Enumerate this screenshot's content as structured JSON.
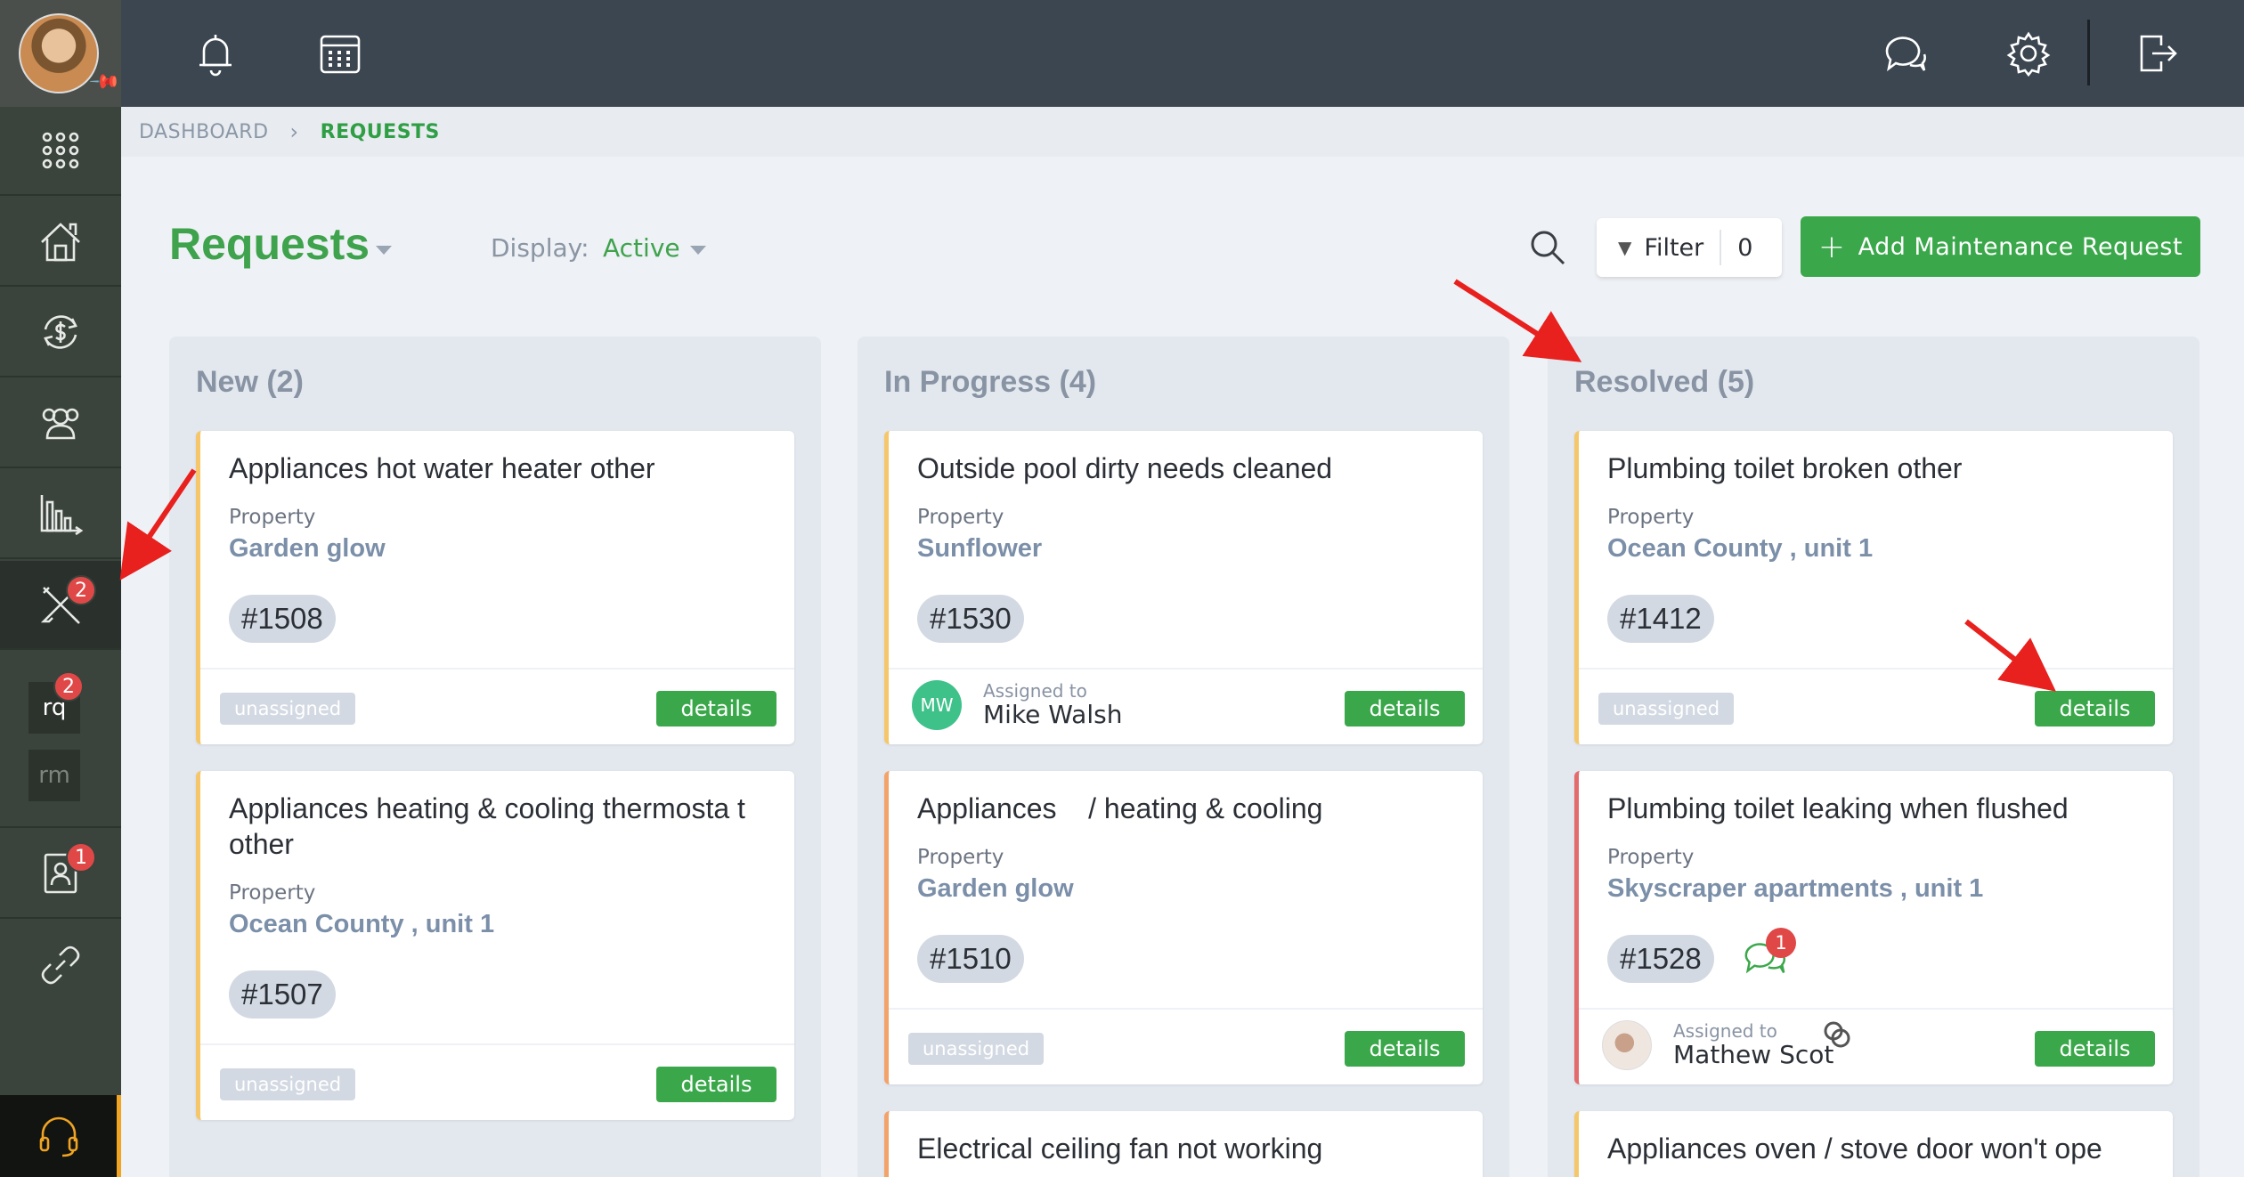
{
  "sidebar": {
    "badges": {
      "maintenance": "2",
      "rq": "2",
      "tenants": "1"
    },
    "sub_items": [
      "rq",
      "rm"
    ]
  },
  "breadcrumb": {
    "items": [
      "DASHBOARD"
    ],
    "current": "REQUESTS"
  },
  "header": {
    "title": "Requests",
    "display_label": "Display:",
    "display_value": "Active",
    "filter_label": "Filter",
    "filter_count": "0",
    "add_button": "Add Maintenance Request"
  },
  "columns": [
    {
      "title": "New (2)",
      "cards": [
        {
          "title": "Appliances hot water heater other",
          "property_label": "Property",
          "property": "Garden glow",
          "id": "#1508",
          "status": "unassigned",
          "details": "details"
        },
        {
          "title": "Appliances heating & cooling thermosta t other",
          "property_label": "Property",
          "property": "Ocean County , unit 1",
          "id": "#1507",
          "status": "unassigned",
          "details": "details"
        }
      ]
    },
    {
      "title": "In Progress (4)",
      "cards": [
        {
          "title": "Outside pool dirty needs cleaned",
          "property_label": "Property",
          "property": "Sunflower",
          "id": "#1530",
          "assigned_label": "Assigned to",
          "assignee_initials": "MW",
          "assignee": "Mike Walsh",
          "details": "details"
        },
        {
          "title": "Appliances    / heating & cooling",
          "property_label": "Property",
          "property": "Garden glow",
          "id": "#1510",
          "status": "unassigned",
          "details": "details"
        },
        {
          "title": "Electrical ceiling fan not working"
        }
      ]
    },
    {
      "title": "Resolved (5)",
      "cards": [
        {
          "title": "Plumbing toilet broken other",
          "property_label": "Property",
          "property": "Ocean County , unit 1",
          "id": "#1412",
          "status": "unassigned",
          "details": "details"
        },
        {
          "title": "Plumbing toilet leaking when flushed",
          "property_label": "Property",
          "property": "Skyscraper apartments , unit 1",
          "id": "#1528",
          "chat_badge": "1",
          "assigned_label": "Assigned to",
          "assignee": "Mathew Scot",
          "details": "details"
        },
        {
          "title": "Appliances oven / stove door won't ope"
        }
      ]
    }
  ],
  "colors": {
    "accent": "#3aa84a",
    "sidebar": "#3a433c",
    "topbar": "#3c4650",
    "badge": "#e04848",
    "annotation_arrow": "#e8201e"
  }
}
